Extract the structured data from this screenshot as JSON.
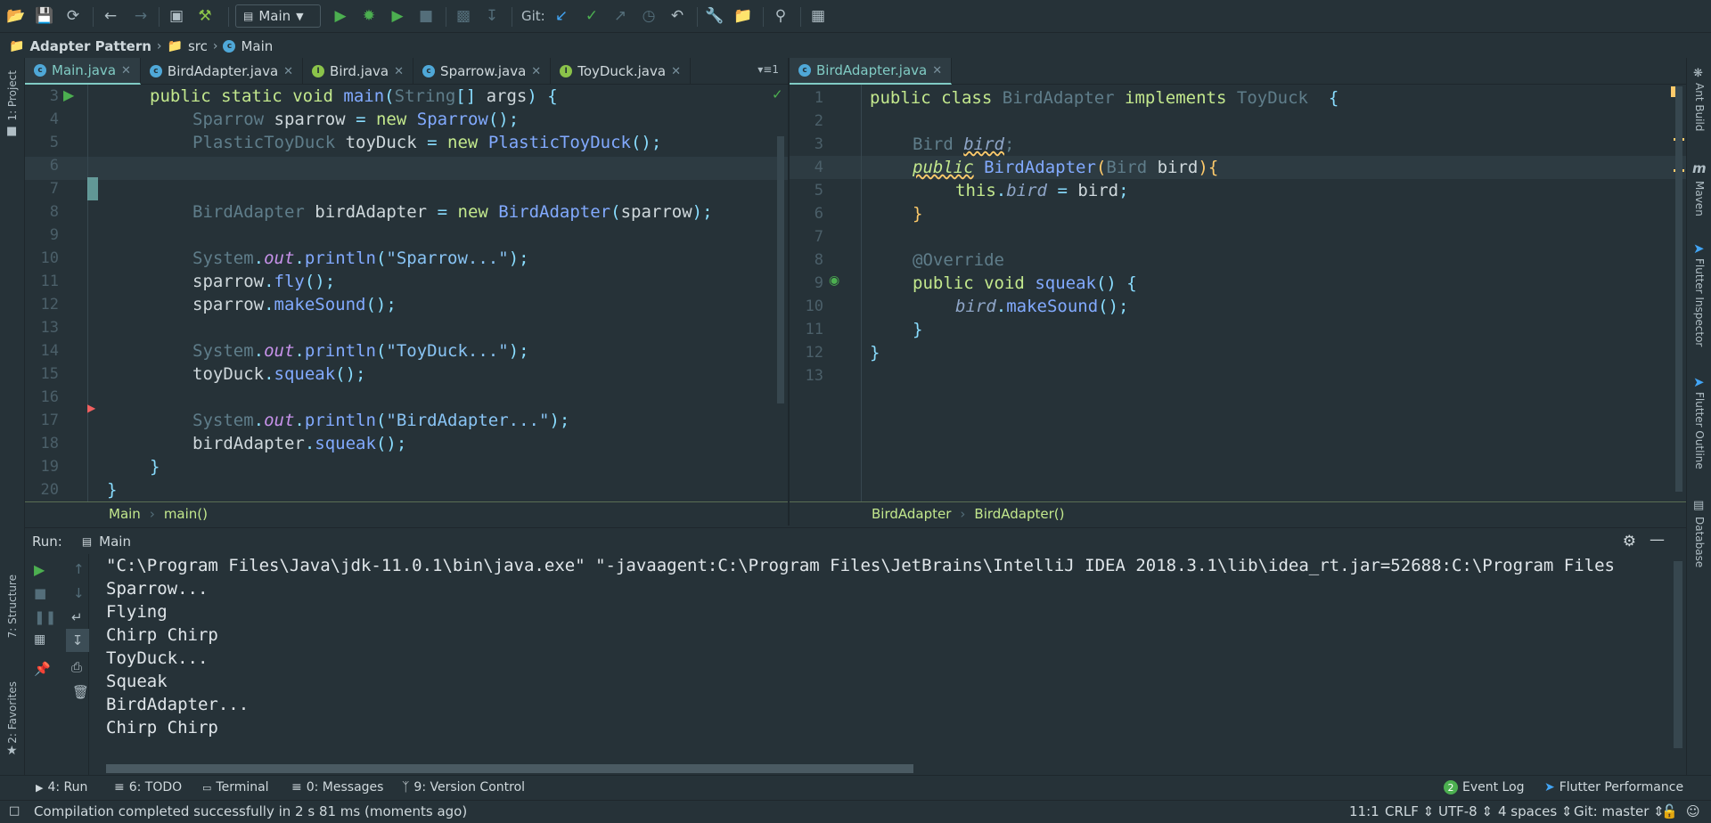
{
  "toolbar": {
    "config": "Main",
    "git_label": "Git:"
  },
  "nav": {
    "project": "Adapter Pattern",
    "folder": "src",
    "file": "Main"
  },
  "left_tabs": [
    "1: Project",
    "7: Structure",
    "2: Favorites"
  ],
  "right_tabs": [
    "Ant Build",
    "Maven",
    "Flutter Inspector",
    "Flutter Outline",
    "Database"
  ],
  "left_editor": {
    "tabs": [
      {
        "label": "Main.java",
        "icon": "c"
      },
      {
        "label": "BirdAdapter.java",
        "icon": "c"
      },
      {
        "label": "Bird.java",
        "icon": "i"
      },
      {
        "label": "Sparrow.java",
        "icon": "c"
      },
      {
        "label": "ToyDuck.java",
        "icon": "i"
      }
    ],
    "line_numbers": [
      "3",
      "4",
      "5",
      "6",
      "7",
      "8",
      "9",
      "10",
      "11",
      "12",
      "13",
      "14",
      "15",
      "16",
      "17",
      "18",
      "19",
      "20"
    ],
    "breadcrumb": [
      "Main",
      "main()"
    ]
  },
  "right_editor": {
    "tabs": [
      {
        "label": "BirdAdapter.java",
        "icon": "c"
      }
    ],
    "line_numbers": [
      "1",
      "2",
      "3",
      "4",
      "5",
      "6",
      "7",
      "8",
      "9",
      "10",
      "11",
      "12",
      "13"
    ],
    "breadcrumb": [
      "BirdAdapter",
      "BirdAdapter()"
    ]
  },
  "run": {
    "label": "Run:",
    "tab": "Main",
    "output": [
      "\"C:\\Program Files\\Java\\jdk-11.0.1\\bin\\java.exe\" \"-javaagent:C:\\Program Files\\JetBrains\\IntelliJ IDEA 2018.3.1\\lib\\idea_rt.jar=52688:C:\\Program Files",
      "Sparrow...",
      "Flying",
      "Chirp Chirp",
      "ToyDuck...",
      "Squeak",
      "BirdAdapter...",
      "Chirp Chirp"
    ]
  },
  "bottom_tabs": {
    "run": "4: Run",
    "todo": "6: TODO",
    "terminal": "Terminal",
    "messages": "0: Messages",
    "vcs": "9: Version Control",
    "event_log_count": "2",
    "event_log": "Event Log",
    "flutter_perf": "Flutter Performance"
  },
  "status": {
    "message": "Compilation completed successfully in 2 s 81 ms (moments ago)",
    "position": "11:1",
    "line_sep": "CRLF",
    "encoding": "UTF-8",
    "indent": "4 spaces",
    "git": "Git: master"
  },
  "colors": {
    "background": "#263238",
    "accent": "#80cbc4",
    "keyword": "#c3e88d"
  }
}
